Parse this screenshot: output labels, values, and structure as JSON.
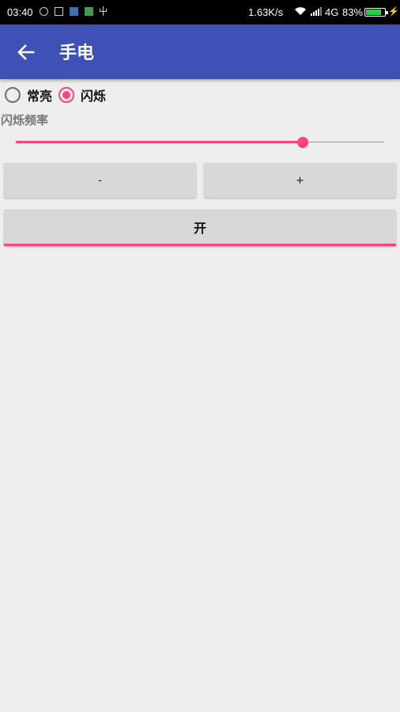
{
  "status_bar": {
    "time": "03:40",
    "speed": "1.63K/s",
    "network": "4G",
    "battery_percent": "83%",
    "battery_level": 0.83,
    "icons": [
      "vpn-icon",
      "screenshot-icon",
      "app-icon",
      "app-icon-green",
      "usb-icon",
      "wifi-icon",
      "signal-icon",
      "battery-icon",
      "charging-icon"
    ]
  },
  "app_bar": {
    "title": "手电",
    "color": "#3f51b5",
    "back_icon": "arrow-left-icon"
  },
  "mode": {
    "options": [
      {
        "label": "常亮",
        "checked": false
      },
      {
        "label": "闪烁",
        "checked": true
      }
    ]
  },
  "frequency": {
    "label": "闪烁频率",
    "slider_value": 0.78
  },
  "buttons": {
    "minus": "-",
    "plus": "+",
    "toggle": "开"
  },
  "colors": {
    "accent": "#ff4081",
    "primary": "#3f51b5",
    "background": "#eeeeee"
  }
}
